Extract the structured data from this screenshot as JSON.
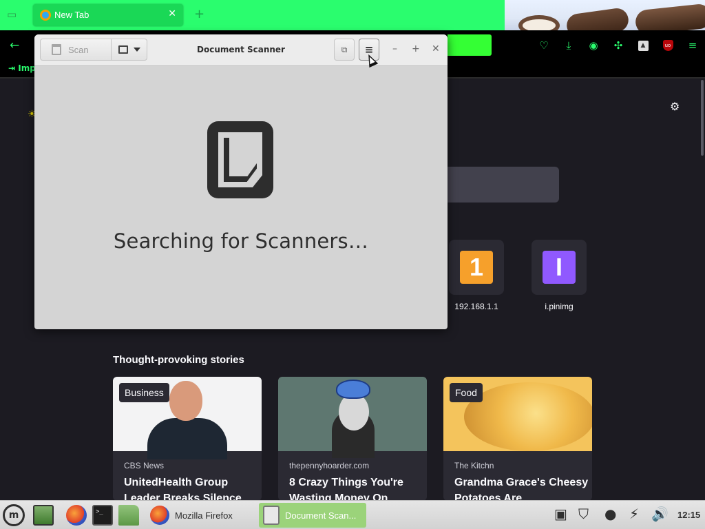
{
  "browser": {
    "tab": {
      "title": "New Tab",
      "close": "✕"
    },
    "new_tab": "+",
    "bookmark_item": "Imp",
    "nav_icons": [
      "pocket-icon",
      "download-icon",
      "account-icon",
      "extensions-icon",
      "vpn-icon",
      "ublock-icon",
      "menu-icon"
    ],
    "accent": "#2afd6e"
  },
  "newtab": {
    "tiles": [
      {
        "label": "192.168.1.1",
        "glyph": "1",
        "color": "#f6a02b"
      },
      {
        "label": "i.pinimg",
        "glyph": "I",
        "color": "#9059ff"
      }
    ],
    "stories_heading": "Thought-provoking stories",
    "cards": [
      {
        "badge": "Business",
        "source": "CBS News",
        "title": "UnitedHealth Group Leader Breaks Silence"
      },
      {
        "badge": "",
        "source": "thepennyhoarder.com",
        "title": "8 Crazy Things You're Wasting Money On"
      },
      {
        "badge": "Food",
        "source": "The Kitchn",
        "title": "Grandma Grace's Cheesy Potatoes Are"
      }
    ]
  },
  "scanner": {
    "title": "Document Scanner",
    "scan_label": "Scan",
    "status": "Searching for Scanners…",
    "window_controls": {
      "minimize": "–",
      "maximize": "+",
      "close": "✕"
    },
    "menu_glyph": "≡"
  },
  "taskbar": {
    "tasks": [
      {
        "label": "Mozilla Firefox"
      },
      {
        "label": "Document Scan..."
      }
    ],
    "clock": "12:15"
  }
}
